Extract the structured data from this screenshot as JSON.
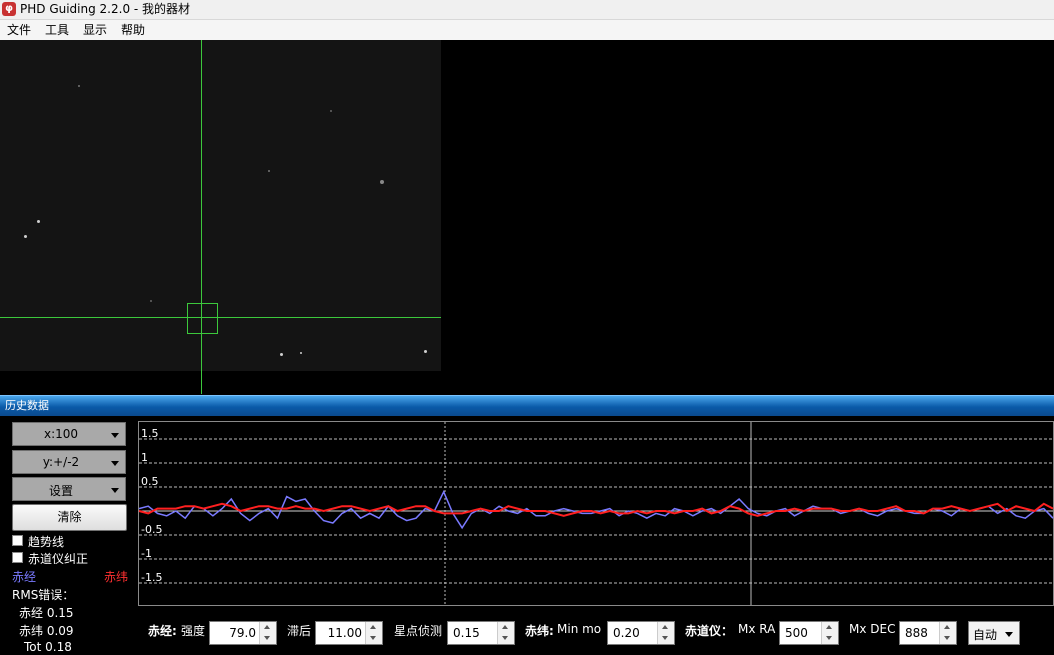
{
  "window": {
    "title": "PHD Guiding 2.2.0 - 我的器材",
    "app_icon": "phd-app-icon"
  },
  "menu": {
    "file": "文件",
    "tools": "工具",
    "view": "显示",
    "help": "帮助"
  },
  "history": {
    "title": "历史数据",
    "x_scale": "x:100",
    "y_scale": "y:+/-2",
    "settings": "设置",
    "clear": "清除",
    "trendlines": "趋势线",
    "correction": "赤道仪纠正",
    "legend_ra": "赤经",
    "legend_dec": "赤纬",
    "rms_title": "RMS错误：",
    "rms_ra": "赤经  0.15",
    "rms_dec": "赤纬  0.09",
    "rms_tot": "Tot  0.18"
  },
  "controls": {
    "ra_label": "赤经:",
    "aggressiveness_label": "强度",
    "aggressiveness": "79.0",
    "hysteresis_label": "滞后",
    "hysteresis": "11.00",
    "star_detect_label": "星点侦测",
    "star_detect": "0.15",
    "dec_label": "赤纬:",
    "min_mo_label": "Min mo",
    "min_mo": "0.20",
    "mount_label": "赤道仪：",
    "max_ra_label": "Mx RA",
    "max_ra": "500",
    "max_dec_label": "Mx DEC",
    "max_dec": "888",
    "dec_mode": "自动"
  },
  "colors": {
    "ra": "#7a7aff",
    "dec": "#ff2020",
    "crosshair": "#3cc83c"
  },
  "chart_data": {
    "type": "line",
    "ylim": [
      -2,
      2
    ],
    "y_ticks": [
      "1.5",
      "1",
      "0.5",
      "-0.5",
      "-1",
      "-1.5"
    ],
    "y_tick_values": [
      1.5,
      1,
      0.5,
      -0.5,
      -1,
      -1.5
    ],
    "series": [
      {
        "name": "赤经",
        "values": [
          0.05,
          0.1,
          -0.05,
          -0.1,
          0.0,
          -0.15,
          0.1,
          0.05,
          -0.1,
          0.05,
          0.25,
          -0.05,
          -0.2,
          -0.05,
          0.05,
          -0.15,
          0.3,
          0.2,
          0.25,
          0.0,
          -0.2,
          -0.25,
          -0.05,
          0.05,
          -0.15,
          -0.05,
          -0.15,
          0.1,
          -0.1,
          -0.2,
          -0.15,
          0.05,
          0.0,
          0.4,
          -0.05,
          -0.35,
          -0.05,
          0.05,
          -0.05,
          0.1,
          0.0,
          -0.05,
          0.05,
          -0.1,
          -0.1,
          0.0,
          0.05,
          0.0,
          -0.05,
          -0.05,
          0.0,
          0.05,
          -0.1,
          0.0,
          -0.05,
          -0.15,
          -0.05,
          -0.1,
          0.05,
          0.0,
          -0.1,
          0.0,
          0.05,
          -0.05,
          0.1,
          0.25,
          0.05,
          -0.05,
          -0.1,
          0.0,
          0.05,
          -0.1,
          0.0,
          0.1,
          0.05,
          0.05,
          -0.05,
          0.0,
          0.05,
          -0.05,
          -0.1,
          0.0,
          0.05,
          0.0,
          -0.05,
          -0.05,
          0.05,
          0.0,
          -0.1,
          0.05,
          0.0,
          0.05,
          0.1,
          -0.05,
          0.05,
          -0.1,
          -0.15,
          0.0,
          0.05,
          -0.15
        ]
      },
      {
        "name": "赤纬",
        "values": [
          0.0,
          -0.05,
          0.05,
          0.05,
          0.05,
          0.1,
          0.1,
          0.05,
          0.1,
          0.15,
          0.1,
          0.0,
          0.05,
          0.1,
          0.1,
          0.05,
          0.05,
          0.1,
          0.05,
          0.05,
          0.0,
          0.05,
          0.1,
          0.1,
          0.05,
          0.0,
          0.05,
          0.1,
          0.0,
          0.05,
          0.1,
          0.1,
          0.0,
          -0.05,
          -0.05,
          -0.05,
          0.0,
          0.05,
          0.0,
          0.0,
          0.1,
          0.05,
          0.0,
          0.0,
          0.0,
          -0.05,
          -0.1,
          -0.05,
          0.0,
          0.0,
          -0.05,
          0.0,
          -0.05,
          -0.05,
          0.0,
          -0.05,
          0.0,
          0.0,
          -0.05,
          0.0,
          0.0,
          0.05,
          -0.05,
          0.0,
          0.1,
          0.05,
          -0.05,
          -0.1,
          -0.05,
          0.0,
          0.0,
          0.05,
          0.0,
          0.05,
          0.05,
          0.05,
          0.0,
          0.0,
          0.05,
          0.0,
          0.0,
          0.05,
          0.1,
          0.0,
          0.0,
          -0.05,
          0.05,
          0.05,
          0.1,
          0.05,
          0.0,
          0.05,
          0.1,
          0.15,
          0.0,
          0.1,
          0.05,
          0.0,
          0.15,
          0.05
        ]
      }
    ]
  }
}
